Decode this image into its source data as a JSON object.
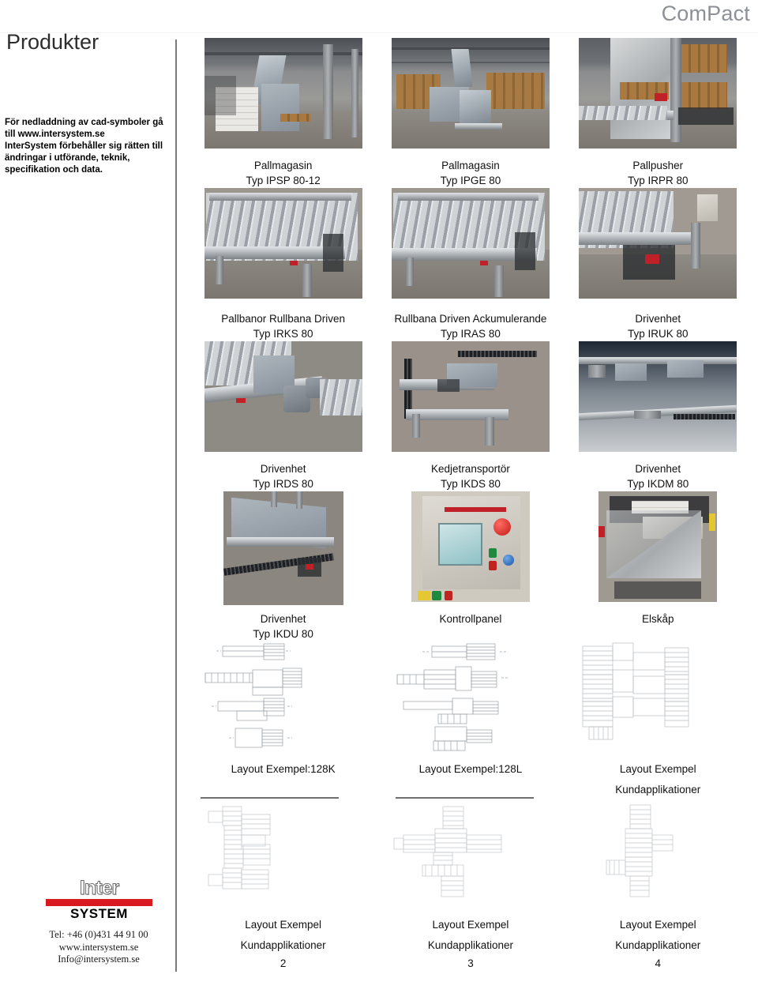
{
  "header": {
    "brand": "ComPact",
    "title": "Produkter"
  },
  "notice": {
    "line1": "För nedladdning av cad-symboler gå",
    "line2": "till www.intersystem.se",
    "line3": "InterSystem förbehåller sig rätten till",
    "line4": "ändringar i utförande, teknik,",
    "line5": "specifikation och data."
  },
  "footer": {
    "logo_top": "Inter",
    "logo_bottom": "SYSTEM",
    "logo_bar_color": "#d81920",
    "tel": "Tel: +46 (0)431 44 91 00",
    "web": "www.intersystem.se",
    "email": "Info@intersystem.se"
  },
  "grid": {
    "rows": [
      {
        "cells": [
          {
            "media": "photo-pallmagasin-ipsp",
            "line1": "Pallmagasin",
            "line2": "Typ IPSP 80-12"
          },
          {
            "media": "photo-pallmagasin-ipge",
            "line1": "Pallmagasin",
            "line2": "Typ IPGE 80"
          },
          {
            "media": "photo-pallpusher-irpr",
            "line1": "Pallpusher",
            "line2": "Typ IRPR 80"
          }
        ]
      },
      {
        "cells": [
          {
            "media": "photo-rullbana-irks",
            "line1": "Pallbanor Rullbana Driven",
            "line2": "Typ IRKS 80"
          },
          {
            "media": "photo-rullbana-iras",
            "line1": "Rullbana Driven Ackumulerande",
            "line2": "Typ IRAS 80"
          },
          {
            "media": "photo-drivenhet-iruk",
            "line1": "Drivenhet",
            "line2": "Typ IRUK 80"
          }
        ]
      },
      {
        "cells": [
          {
            "media": "photo-drivenhet-irds",
            "line1": "Drivenhet",
            "line2": "Typ IRDS 80"
          },
          {
            "media": "photo-kedjetransportor-ikds",
            "line1": "Kedjetransportör",
            "line2": "Typ IKDS 80"
          },
          {
            "media": "photo-drivenhet-ikdm",
            "line1": "Drivenhet",
            "line2": "Typ IKDM 80"
          }
        ]
      },
      {
        "cells": [
          {
            "media": "photo-drivenhet-ikdu",
            "line1": "Drivenhet",
            "line2": "Typ IKDU 80"
          },
          {
            "media": "photo-kontrollpanel",
            "line1": "Kontrollpanel",
            "line2": ""
          },
          {
            "media": "photo-elskap",
            "line1": "Elskåp",
            "line2": ""
          }
        ]
      },
      {
        "cells": [
          {
            "media": "cad-layout-128k",
            "line1": "Layout Exempel:128K",
            "line2": ""
          },
          {
            "media": "cad-layout-128l",
            "line1": "Layout Exempel:128L",
            "line2": ""
          },
          {
            "media": "cad-layout-kund-1",
            "line1": "Layout Exempel",
            "line2": "Kundapplikationer"
          }
        ]
      },
      {
        "cells": [
          {
            "media": "cad-layout-kund-2",
            "line1": "Layout Exempel",
            "line2": "Kundapplikationer",
            "page": "2"
          },
          {
            "media": "cad-layout-kund-3",
            "line1": "Layout Exempel",
            "line2": "Kundapplikationer",
            "page": "3"
          },
          {
            "media": "cad-layout-kund-4",
            "line1": "Layout Exempel",
            "line2": "Kundapplikationer",
            "page": "4"
          }
        ]
      }
    ]
  }
}
